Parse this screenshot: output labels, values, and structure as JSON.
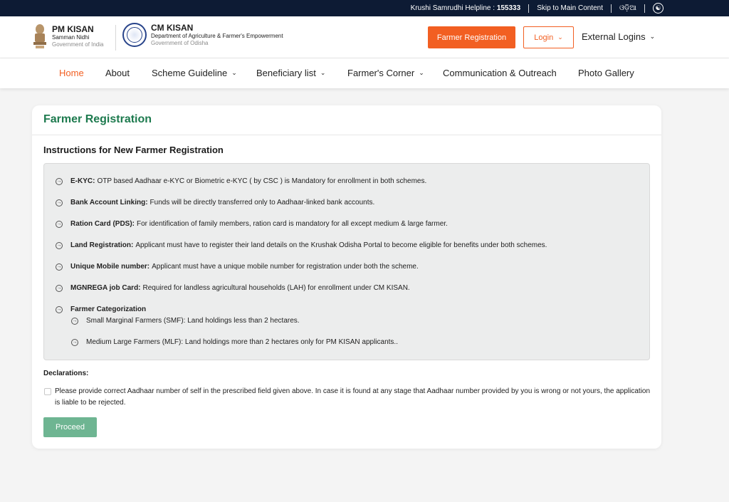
{
  "topbar": {
    "helpline_label": "Krushi Samrudhi Helpline : ",
    "helpline_number": "155333",
    "skip_link": "Skip to Main Content",
    "language": "ଓଡ଼ିଆ",
    "accessibility_icon": "accessibility-icon"
  },
  "header": {
    "pm_kisan": {
      "title": "PM KISAN",
      "subtitle": "Samman Nidhi",
      "org": "Government of India",
      "logo_icon": "national-emblem-icon"
    },
    "cm_kisan": {
      "title": "CM KISAN",
      "subtitle": "Department of Agriculture & Farmer's Empowerment",
      "org": "Government of Odisha",
      "logo_icon": "odisha-seal-icon"
    },
    "register_button": "Farmer Registration",
    "login_button": "Login",
    "external_logins": "External Logins"
  },
  "nav": {
    "items": [
      {
        "label": "Home",
        "active": true
      },
      {
        "label": "About"
      },
      {
        "label": "Scheme Guideline",
        "dropdown": true
      },
      {
        "label": "Beneficiary list",
        "dropdown": true
      },
      {
        "label": "Farmer's Corner",
        "dropdown": true
      },
      {
        "label": "Communication & Outreach"
      },
      {
        "label": "Photo Gallery"
      }
    ]
  },
  "card": {
    "title": "Farmer Registration",
    "instructions_title": "Instructions for New Farmer Registration",
    "instructions": [
      {
        "term": "E-KYC:",
        "text": "OTP based Aadhaar e-KYC or Biometric e-KYC ( by CSC ) is Mandatory for enrollment in both schemes."
      },
      {
        "term": "Bank Account Linking:",
        "text": "Funds will be directly transferred only to Aadhaar-linked bank accounts."
      },
      {
        "term": "Ration Card (PDS):",
        "text": "For identification of family members, ration card is mandatory for all except medium & large farmer."
      },
      {
        "term": "Land Registration:",
        "text": "Applicant must have to register their land details on the Krushak Odisha Portal to become eligible for benefits under both schemes."
      },
      {
        "term": "Unique Mobile number:",
        "text": "Applicant must have a unique mobile number for registration under both the scheme."
      },
      {
        "term": "MGNREGA job Card:",
        "text": "Required for landless agricultural households (LAH) for enrollment under CM KISAN."
      },
      {
        "term": "Farmer Categorization",
        "text": ""
      }
    ],
    "sub_instructions": [
      "Small Marginal Farmers (SMF): Land holdings less than 2 hectares.",
      "Medium Large Farmers (MLF): Land holdings more than 2 hectares only for PM KISAN applicants.."
    ],
    "declarations_title": "Declarations:",
    "declaration_text": "Please provide correct Aadhaar number of self in the prescribed field given above. In case it is found at any stage that Aadhaar number provided by you is wrong or not yours, the application is liable to be rejected.",
    "proceed_button": "Proceed"
  },
  "colors": {
    "accent": "#f25f22",
    "topbar_bg": "#0d1b34",
    "card_title": "#1d7a4e",
    "proceed_bg": "#6eb592"
  }
}
